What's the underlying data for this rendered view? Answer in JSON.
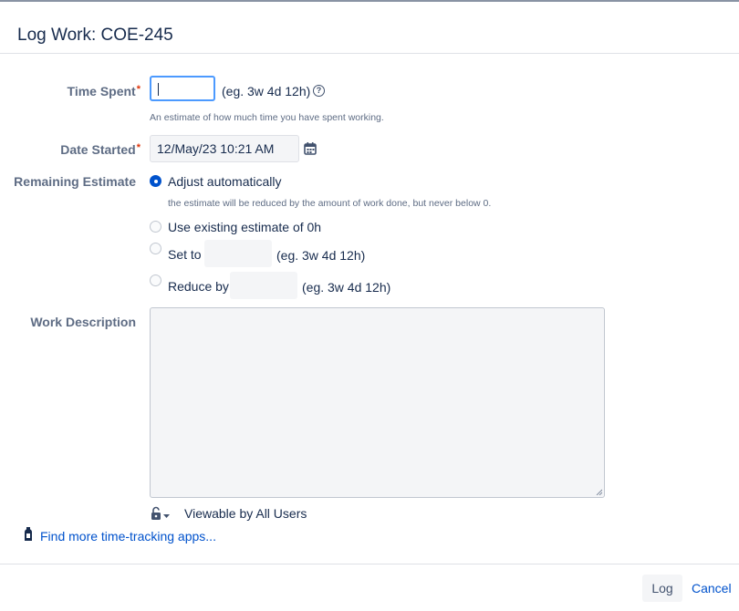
{
  "dialog": {
    "title": "Log Work: COE-245"
  },
  "time_spent": {
    "label": "Time Spent",
    "required_marker": "*",
    "value": "",
    "format_hint": "(eg. 3w 4d 12h)",
    "description": "An estimate of how much time you have spent working."
  },
  "date_started": {
    "label": "Date Started",
    "required_marker": "*",
    "value": "12/May/23 10:21 AM"
  },
  "remaining_estimate": {
    "label": "Remaining Estimate",
    "options": [
      {
        "label": "Adjust automatically",
        "checked": true,
        "description": "the estimate will be reduced by the amount of work done, but never below 0."
      },
      {
        "label": "Use existing estimate of 0h",
        "checked": false
      },
      {
        "label": "Set to",
        "checked": false,
        "format_hint": "(eg. 3w 4d 12h)"
      },
      {
        "label": "Reduce by",
        "checked": false,
        "format_hint": "(eg. 3w 4d 12h)"
      }
    ]
  },
  "work_description": {
    "label": "Work Description",
    "value": ""
  },
  "visibility": {
    "label": "Viewable by All Users"
  },
  "links": {
    "more_apps": "Find more time-tracking apps..."
  },
  "footer": {
    "log_label": "Log",
    "cancel_label": "Cancel"
  },
  "colors": {
    "accent": "#0052cc",
    "focus_border": "#4c9aff",
    "required": "#de350b",
    "label_text": "#5e6c84"
  }
}
